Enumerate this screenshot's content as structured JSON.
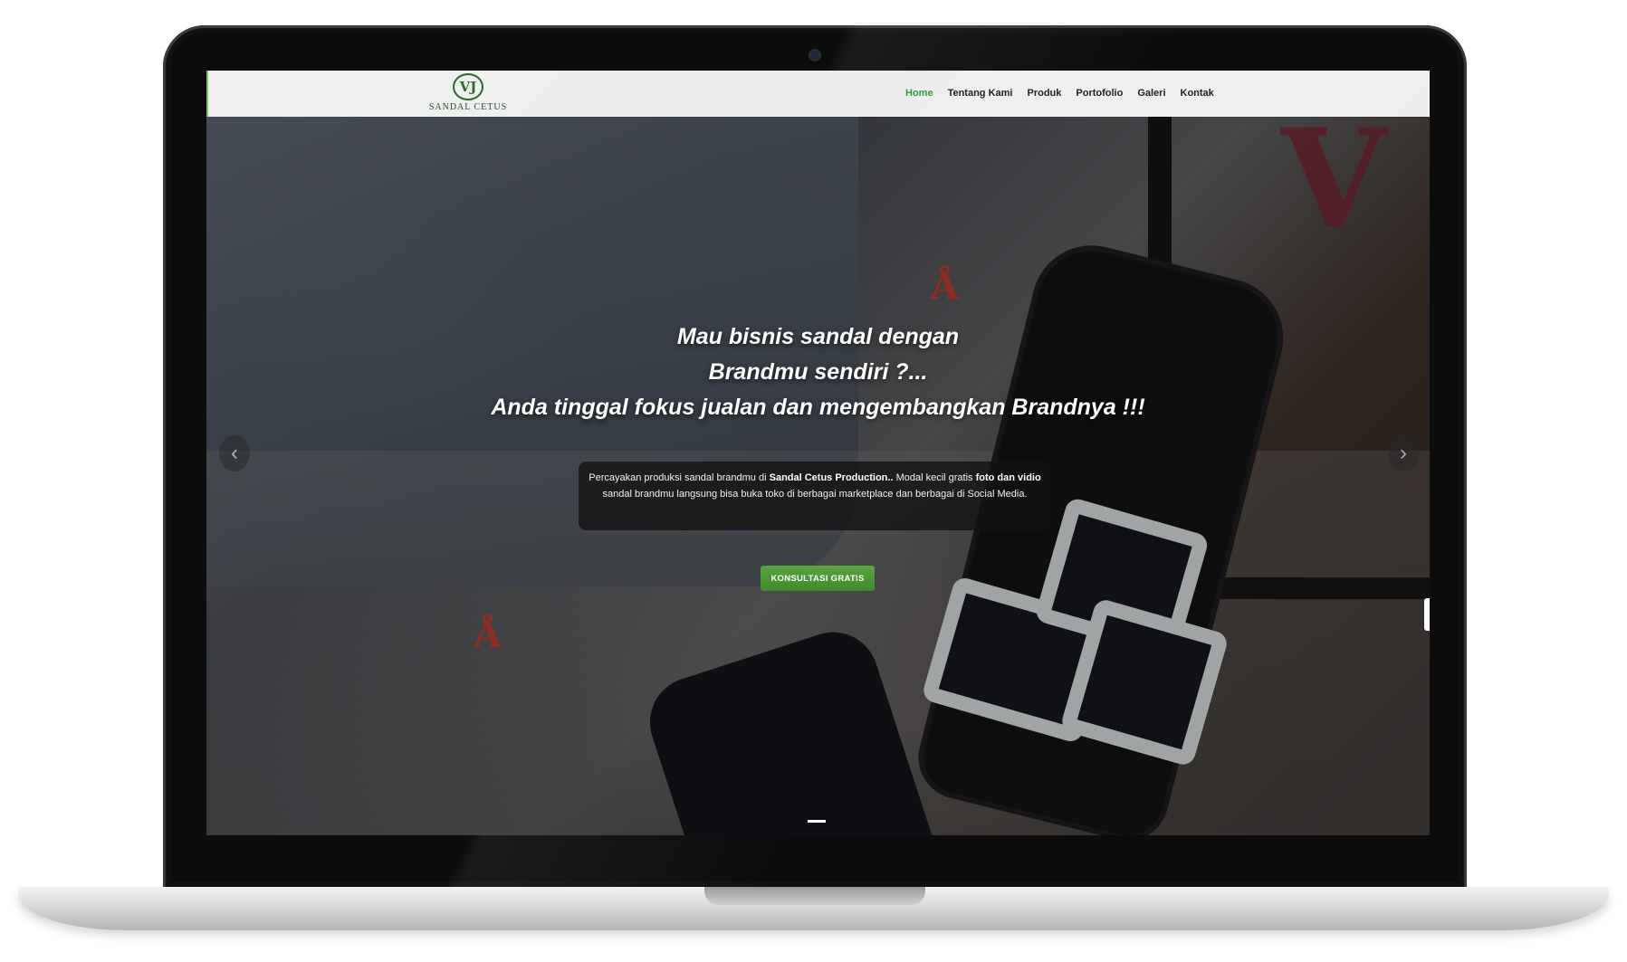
{
  "brand": {
    "logo_mark": "VJ",
    "name": "SANDAL CETUS"
  },
  "nav": {
    "items": [
      {
        "label": "Home",
        "active": true
      },
      {
        "label": "Tentang Kami",
        "active": false
      },
      {
        "label": "Produk",
        "active": false
      },
      {
        "label": "Portofolio",
        "active": false
      },
      {
        "label": "Galeri",
        "active": false
      },
      {
        "label": "Kontak",
        "active": false
      }
    ]
  },
  "hero": {
    "headline_1": "Mau bisnis sandal dengan",
    "headline_2": "Brandmu sendiri ?...",
    "headline_3": "Anda tinggal fokus jualan dan mengembangkan Brandnya !!!",
    "desc_1": "Percayakan produksi sandal brandmu di ",
    "desc_bold_1": "Sandal Cetus Production..",
    "desc_2": " Modal kecil  gratis ",
    "desc_bold_2": "foto dan vidio",
    "desc_3": " sandal brandmu langsung bisa buka toko di berbagai marketplace dan berbagai di Social Media.",
    "cta_label": "KONSULTASI GRATIS"
  },
  "carousel": {
    "prev_icon": "‹",
    "next_icon": "›",
    "slide_count": 1,
    "active_slide": 1
  },
  "colors": {
    "accent": "#2e9e3a",
    "cta": "#4f9a36",
    "nav_bg": "#f5f5f5"
  }
}
